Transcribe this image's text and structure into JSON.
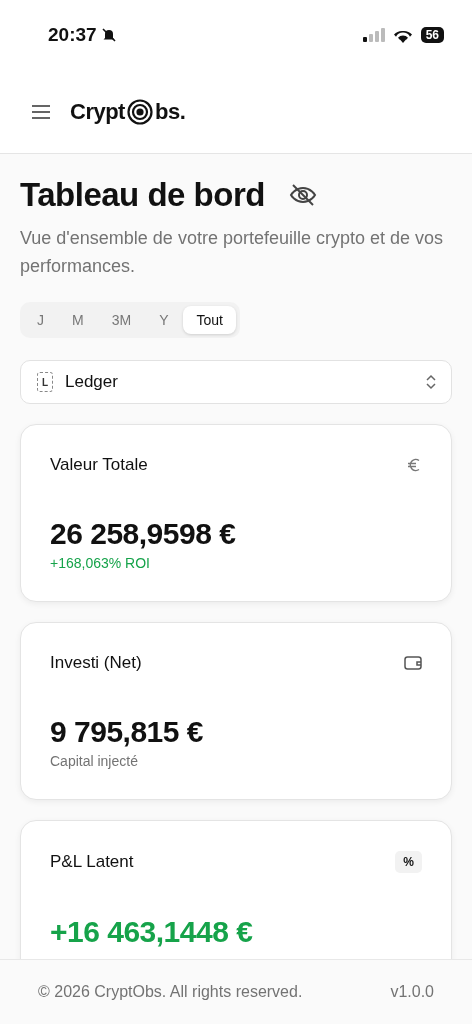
{
  "status_bar": {
    "time": "20:37",
    "battery": "56"
  },
  "header": {
    "logo_left": "Crypt",
    "logo_right": "bs."
  },
  "page": {
    "title": "Tableau de bord",
    "subtitle": "Vue d'ensemble de votre portefeuille crypto et de vos performances."
  },
  "periods": [
    {
      "label": "J",
      "selected": false
    },
    {
      "label": "M",
      "selected": false
    },
    {
      "label": "3M",
      "selected": false
    },
    {
      "label": "Y",
      "selected": false
    },
    {
      "label": "Tout",
      "selected": true
    }
  ],
  "wallet_select": {
    "value": "Ledger",
    "badge": "L"
  },
  "cards": [
    {
      "title": "Valeur Totale",
      "kind": "euro",
      "value": "26 258,9598 €",
      "positive": false,
      "note": "+168,063% ROI",
      "note_positive": true
    },
    {
      "title": "Investi (Net)",
      "kind": "wallet",
      "value": "9 795,815 €",
      "positive": false,
      "note": "Capital injecté",
      "note_positive": false
    },
    {
      "title": "P&L Latent",
      "kind": "percent",
      "badge": "%",
      "value": "+16 463,1448 €",
      "positive": true
    }
  ],
  "footer": {
    "copyright": "© 2026 CryptObs. All rights reserved.",
    "version": "v1.0.0"
  }
}
